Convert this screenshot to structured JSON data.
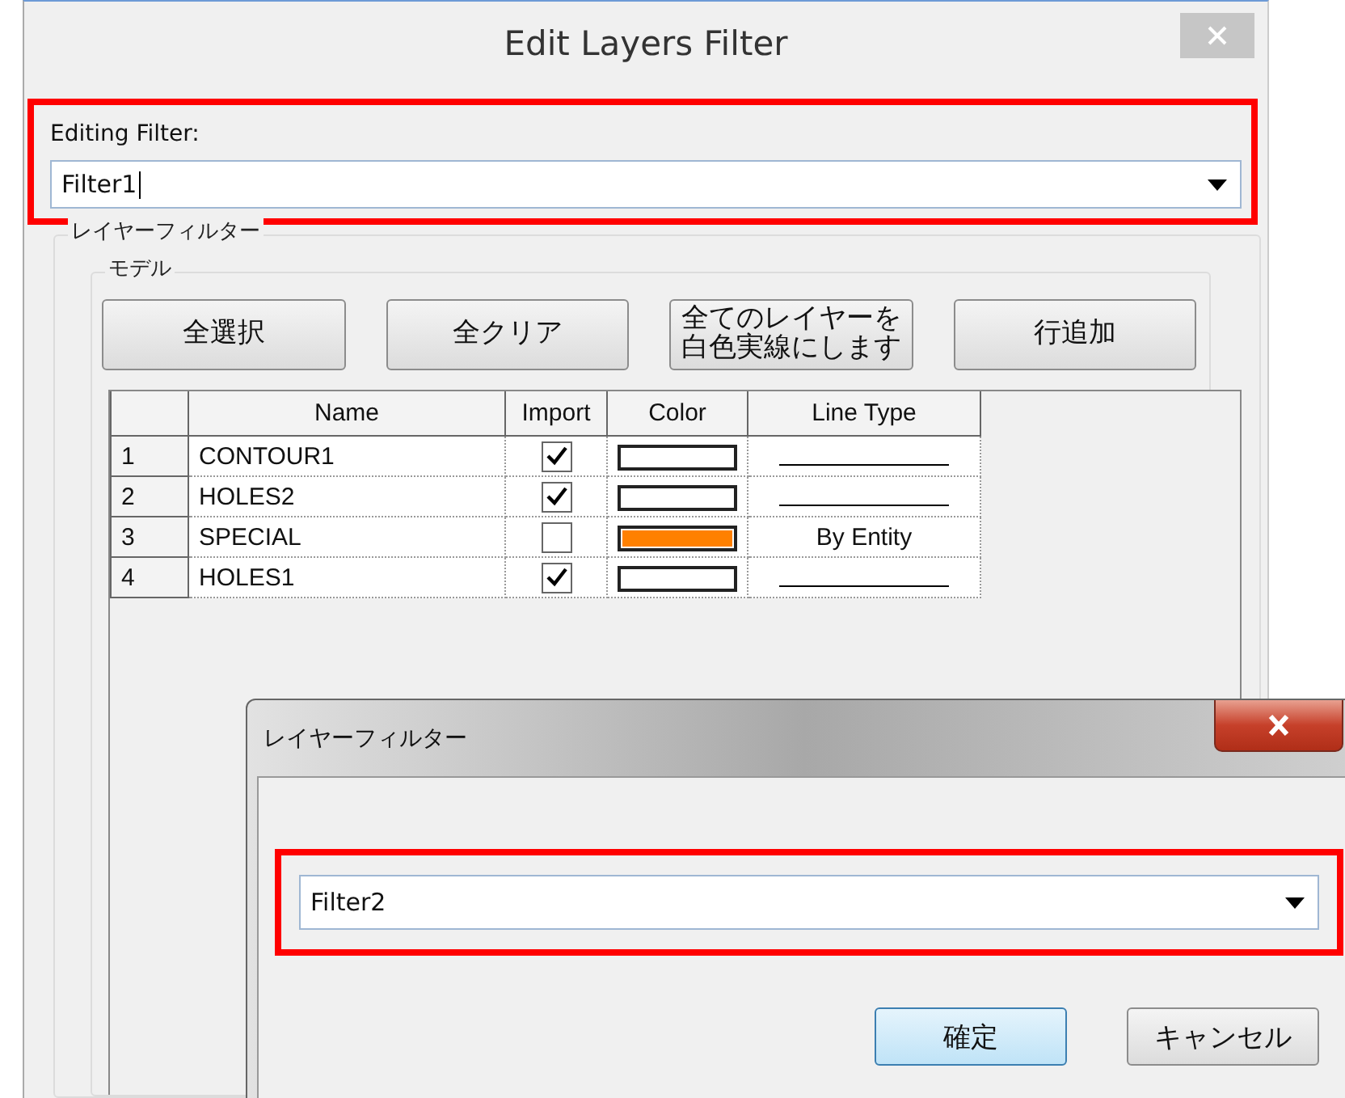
{
  "window": {
    "title": "Edit Layers Filter"
  },
  "editing_filter": {
    "label": "Editing Filter:",
    "value": "Filter1",
    "highlighted": true
  },
  "layer_filter_group": {
    "label": "レイヤーフィルター",
    "model_group": {
      "label": "モデル"
    }
  },
  "buttons": [
    {
      "label": "全選択"
    },
    {
      "label": "全クリア"
    },
    {
      "label": "全てのレイヤーを白色実線にします"
    },
    {
      "label": "行追加"
    }
  ],
  "table": {
    "columns": [
      "Name",
      "Import",
      "Color",
      "Line Type"
    ],
    "rows": [
      {
        "number": "1",
        "name": "CONTOUR1",
        "import": true,
        "color": "#ffffff",
        "line_type": {
          "kind": "line"
        }
      },
      {
        "number": "2",
        "name": "HOLES2",
        "import": true,
        "color": "#ffffff",
        "line_type": {
          "kind": "line"
        }
      },
      {
        "number": "3",
        "name": "SPECIAL",
        "import": false,
        "color": "#ff8000",
        "line_type": {
          "kind": "text",
          "text": "By Entity"
        }
      },
      {
        "number": "4",
        "name": "HOLES1",
        "import": true,
        "color": "#ffffff",
        "line_type": {
          "kind": "line"
        }
      }
    ]
  },
  "dialog": {
    "title": "レイヤーフィルター",
    "value": "Filter2",
    "highlighted": true,
    "buttons": [
      {
        "label": "確定",
        "default": true
      },
      {
        "label": "キャンセル",
        "default": false
      }
    ]
  }
}
